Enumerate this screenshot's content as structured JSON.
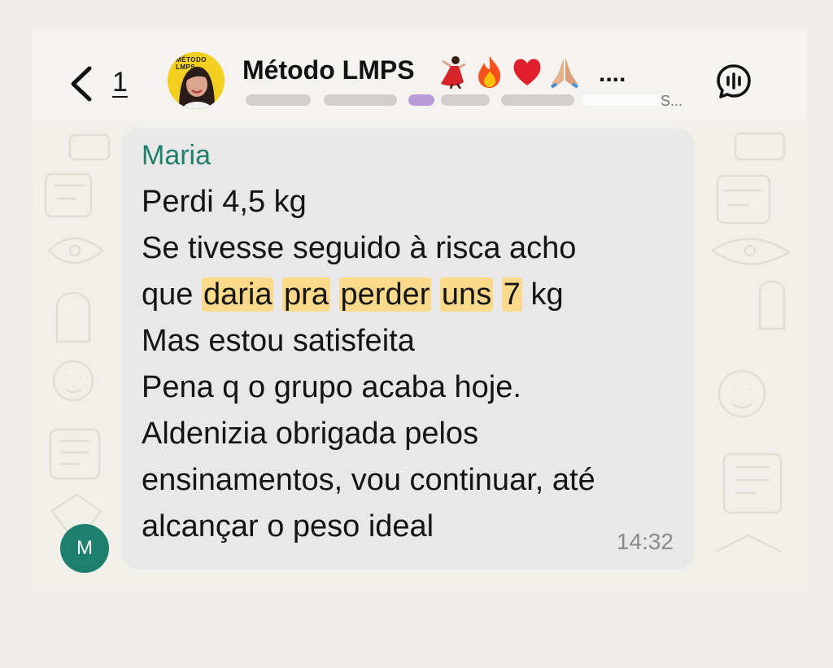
{
  "header": {
    "back_count": "1",
    "avatar_label": "MÉTODO LMPS",
    "title": "Método LMPS",
    "title_emojis": [
      "💃",
      "🔥",
      "❤️",
      "🙏🏼"
    ],
    "title_ellipsis": "....",
    "subtitle_end": "S..."
  },
  "message": {
    "sender": "Maria",
    "lines": [
      {
        "parts": [
          {
            "text": "Perdi 4,5 kg",
            "hl": false
          }
        ]
      },
      {
        "parts": [
          {
            "text": "Se tivesse seguido à risca acho",
            "hl": false
          }
        ]
      },
      {
        "parts": [
          {
            "text": "que ",
            "hl": false
          },
          {
            "text": "daria",
            "hl": true
          },
          {
            "text": " ",
            "hl": false
          },
          {
            "text": "pra",
            "hl": true
          },
          {
            "text": " ",
            "hl": false
          },
          {
            "text": "perder",
            "hl": true
          },
          {
            "text": " ",
            "hl": false
          },
          {
            "text": "uns",
            "hl": true
          },
          {
            "text": " ",
            "hl": false
          },
          {
            "text": "7",
            "hl": true
          },
          {
            "text": " kg",
            "hl": false
          }
        ]
      },
      {
        "parts": [
          {
            "text": "Mas estou satisfeita",
            "hl": false
          }
        ]
      },
      {
        "parts": [
          {
            "text": "Pena q o grupo acaba hoje.",
            "hl": false
          }
        ]
      },
      {
        "parts": [
          {
            "text": "Aldenizia obrigada pelos",
            "hl": false
          }
        ]
      },
      {
        "parts": [
          {
            "text": "ensinamentos, vou continuar, até",
            "hl": false
          }
        ]
      },
      {
        "parts": [
          {
            "text": "alcançar o peso ideal",
            "hl": false
          }
        ]
      }
    ],
    "time": "14:32",
    "sender_initial": "M"
  },
  "colors": {
    "highlight": "#fbd98a",
    "sender_name": "#1f7f6d",
    "bubble": "#e9e8e8"
  },
  "icons": [
    "chevron-left-icon",
    "voice-chat-icon"
  ]
}
